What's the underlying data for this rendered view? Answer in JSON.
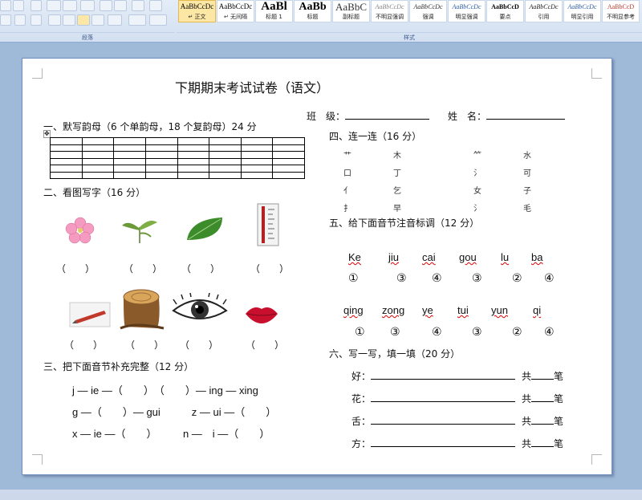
{
  "ribbon": {
    "groups": {
      "paragraph": "段落",
      "styles": "样式"
    },
    "styles": [
      {
        "sample": "AaBbCcDc",
        "label": "↵ 正文",
        "active": true
      },
      {
        "sample": "AaBbCcDc",
        "label": "↵ 无间隔"
      },
      {
        "sample": "AaBl",
        "label": "标题 1"
      },
      {
        "sample": "AaBb",
        "label": "标题"
      },
      {
        "sample": "AaBbC",
        "label": "副标题"
      },
      {
        "sample": "AaBbCcDc",
        "label": "不明显强调"
      },
      {
        "sample": "AaBbCcDc",
        "label": "强调"
      },
      {
        "sample": "AaBbCcDc",
        "label": "明显强调"
      },
      {
        "sample": "AaBbCcD",
        "label": "要点"
      },
      {
        "sample": "AaBbCcDc",
        "label": "引用"
      },
      {
        "sample": "AaBbCcDc",
        "label": "明显引用"
      },
      {
        "sample": "AaBbCcD",
        "label": "不明显参考"
      }
    ]
  },
  "doc": {
    "title": "下期期末考试试卷（语文）",
    "class_label": "班　级：",
    "name_label": "姓　名：",
    "s1": "一、默写韵母（6 个单韵母，18 个复韵母）24 分",
    "s2": "二、看图写字（16 分）",
    "paren": "（　　）",
    "s3": "三、把下面音节补充完整（12 分）",
    "s3_rows": [
      "j — ie —（　　）　（　　）— ing — xing",
      "g —（　　）— gui　　　z — ui —（　　）",
      "x — ie —（　　）　　　n —　i —（　　）"
    ],
    "s4": "四、连一连（16 分）",
    "s4_left": [
      "⺾",
      "口",
      "亻",
      "扌"
    ],
    "s4_midL": [
      "木",
      "丁",
      "乞",
      "早"
    ],
    "s4_midR": [
      "⺮",
      "氵",
      "女",
      "氵"
    ],
    "s4_right": [
      "水",
      "可",
      "子",
      "毛"
    ],
    "s5": "五、给下面音节注音标调（12 分）",
    "s5_row1": [
      "Ke",
      "jiu",
      "cai",
      "gou",
      "lu",
      "ba"
    ],
    "s5_tone1": [
      "①",
      "③",
      "④",
      "③",
      "②",
      "④"
    ],
    "s5_row2": [
      "qing",
      "zong",
      "ye",
      "tui",
      "yun",
      "qi"
    ],
    "s5_tone2": [
      "①",
      "③",
      "④",
      "③",
      "②",
      "④"
    ],
    "s6": "六、写一写，填一填（20 分）",
    "s6_chars": [
      "好：",
      "花：",
      "舌：",
      "方："
    ],
    "s6_gong": "共",
    "s6_bi": "笔"
  }
}
